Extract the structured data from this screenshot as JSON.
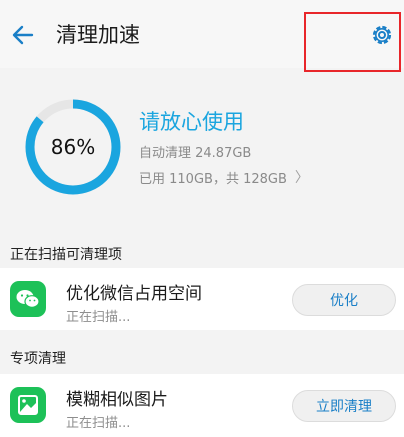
{
  "header": {
    "title": "清理加速",
    "back_icon": "back-arrow-icon",
    "settings_icon": "gear-icon"
  },
  "summary": {
    "percent_label": "86%",
    "percent_value": 0.86,
    "status_title": "请放心使用",
    "auto_clean": "自动清理 24.87GB",
    "storage": "已用 110GB，共 128GB",
    "chevron": "〉"
  },
  "scanning_section": {
    "label": "正在扫描可清理项",
    "item": {
      "title": "优化微信占用空间",
      "subtitle": "正在扫描...",
      "button": "优化",
      "icon": "wechat-icon"
    }
  },
  "special_section": {
    "label": "专项清理",
    "item": {
      "title": "模糊相似图片",
      "subtitle": "正在扫描...",
      "button": "立即清理",
      "icon": "image-icon"
    }
  },
  "colors": {
    "accent": "#1aa5df",
    "ring_track": "#e6e6e6",
    "app_green": "#1dc158",
    "highlight": "#e8262a"
  }
}
